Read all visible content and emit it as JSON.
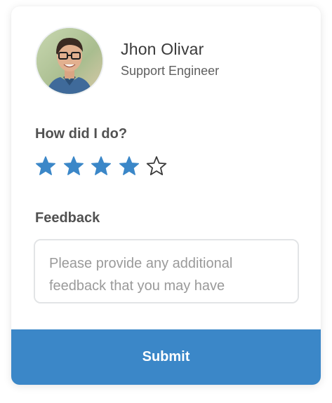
{
  "profile": {
    "name": "Jhon Olivar",
    "role": "Support Engineer"
  },
  "rating": {
    "question": "How did I do?",
    "value": 4,
    "max": 5,
    "filled_color": "#3b87c8",
    "empty_color": "#3a3a3a"
  },
  "feedback": {
    "label": "Feedback",
    "placeholder": "Please provide any additional feedback that you may have",
    "value": ""
  },
  "submit": {
    "label": "Submit",
    "color": "#3b87c8"
  }
}
